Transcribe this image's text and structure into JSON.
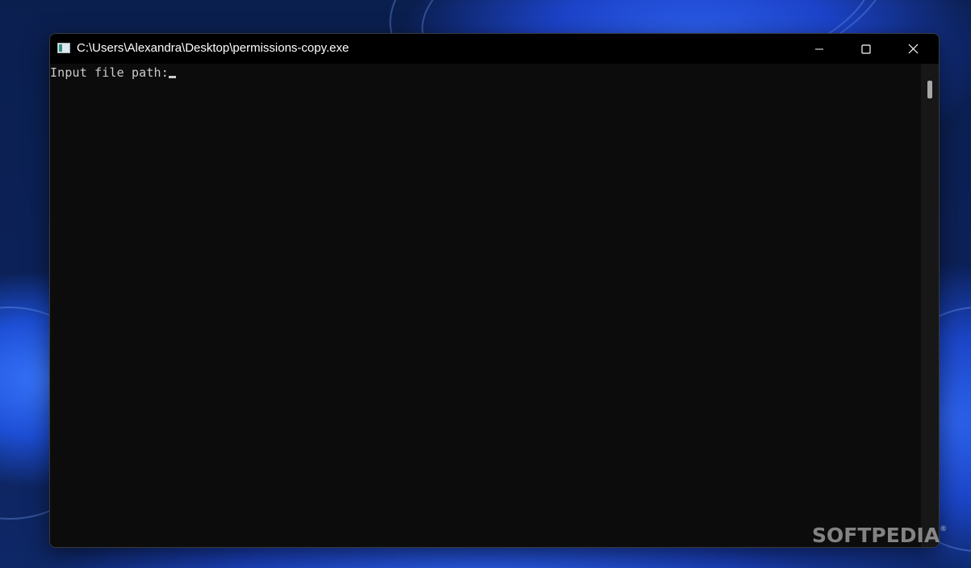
{
  "window": {
    "title": "C:\\Users\\Alexandra\\Desktop\\permissions-copy.exe",
    "icon": "console-app-icon",
    "controls": {
      "minimize_icon": "minimize-icon",
      "maximize_icon": "maximize-icon",
      "close_icon": "close-icon"
    }
  },
  "console": {
    "prompt": "Input file path:",
    "text_color": "#cccccc",
    "background_color": "#0c0c0c"
  },
  "watermark": {
    "text": "SOFTPEDIA",
    "mark": "®"
  }
}
